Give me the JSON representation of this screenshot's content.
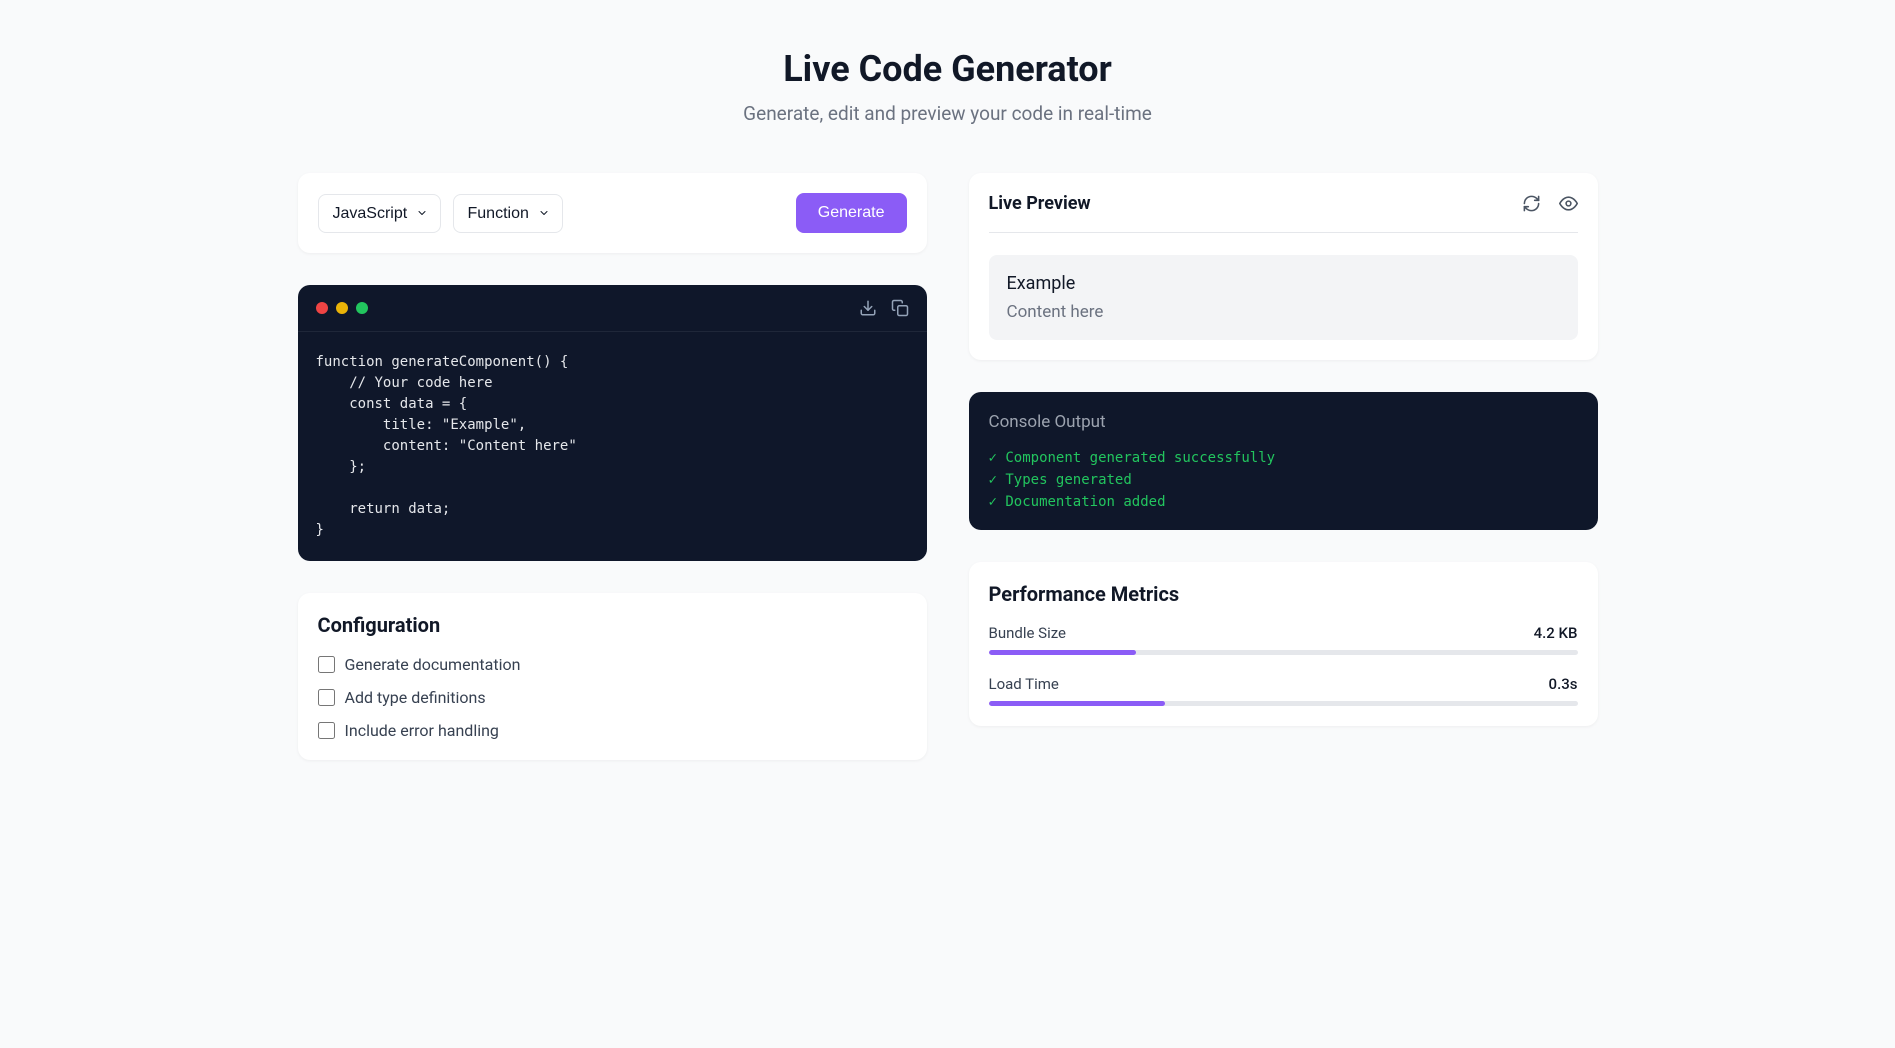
{
  "header": {
    "title": "Live Code Generator",
    "subtitle": "Generate, edit and preview your code in real-time"
  },
  "toolbar": {
    "language_selected": "JavaScript",
    "type_selected": "Function",
    "generate_label": "Generate"
  },
  "editor": {
    "code": "function generateComponent() {\n    // Your code here\n    const data = {\n        title: \"Example\",\n        content: \"Content here\"\n    };\n    \n    return data;\n}"
  },
  "configuration": {
    "title": "Configuration",
    "options": [
      {
        "label": "Generate documentation",
        "checked": false
      },
      {
        "label": "Add type definitions",
        "checked": false
      },
      {
        "label": "Include error handling",
        "checked": false
      }
    ]
  },
  "preview": {
    "title": "Live Preview",
    "item_title": "Example",
    "item_content": "Content here"
  },
  "console": {
    "title": "Console Output",
    "lines": [
      "✓ Component generated successfully",
      "✓ Types generated",
      "✓ Documentation added"
    ]
  },
  "metrics": {
    "title": "Performance Metrics",
    "items": [
      {
        "label": "Bundle Size",
        "value": "4.2 KB",
        "percent": 25
      },
      {
        "label": "Load Time",
        "value": "0.3s",
        "percent": 30
      }
    ]
  }
}
